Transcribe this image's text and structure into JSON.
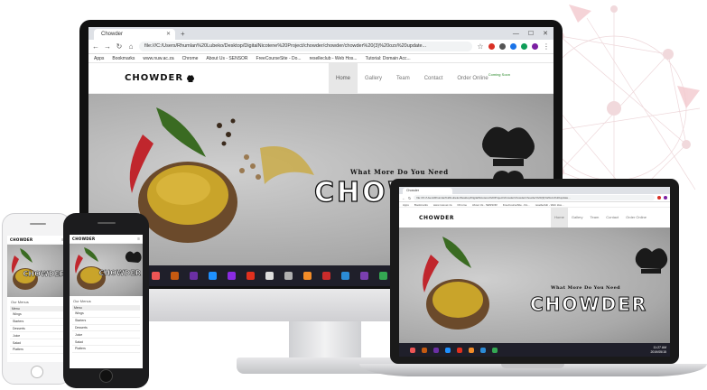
{
  "browser": {
    "tab_title": "Chowder",
    "address": "file:///C:/Users/Rhumlan%20Lubeko/Desktop/DigitalNicotene%20Project/chowder/chowder/chowder%20(3)%20ozs%20update...",
    "bookmarks": [
      "Apps",
      "Bookmarks",
      "www.nuw.ac.za",
      "Chrome",
      "About Us - SENSOR",
      "FreeCourseSite - Do...",
      "reselleclub - Web Hos...",
      "Tutorial: Domain Acc..."
    ]
  },
  "site": {
    "logo_text": "CHOWDER",
    "nav": [
      {
        "label": "Home"
      },
      {
        "label": "Gallery"
      },
      {
        "label": "Team"
      },
      {
        "label": "Contact"
      },
      {
        "label": "Order Online"
      }
    ],
    "coming_soon": "Coming Soon",
    "hero_tagline": "What More Do You Need",
    "hero_name": "CHOWDER"
  },
  "laptop": {
    "clock_time": "11:27 AM",
    "clock_date": "2019/05/15"
  },
  "phone": {
    "menu_title": "Our Menus",
    "menu_header": "Menu",
    "menu_items": [
      "Wings",
      "Starters",
      "Desserts",
      "Juice",
      "Salad",
      "Platters"
    ]
  },
  "colors": {
    "hero_bg": "#a9a9a9",
    "taskbar": "#1f1f2a",
    "accent_chili": "#c0262d",
    "accent_spice": "#c9a42a",
    "network_lines": "#e8c9cc"
  }
}
